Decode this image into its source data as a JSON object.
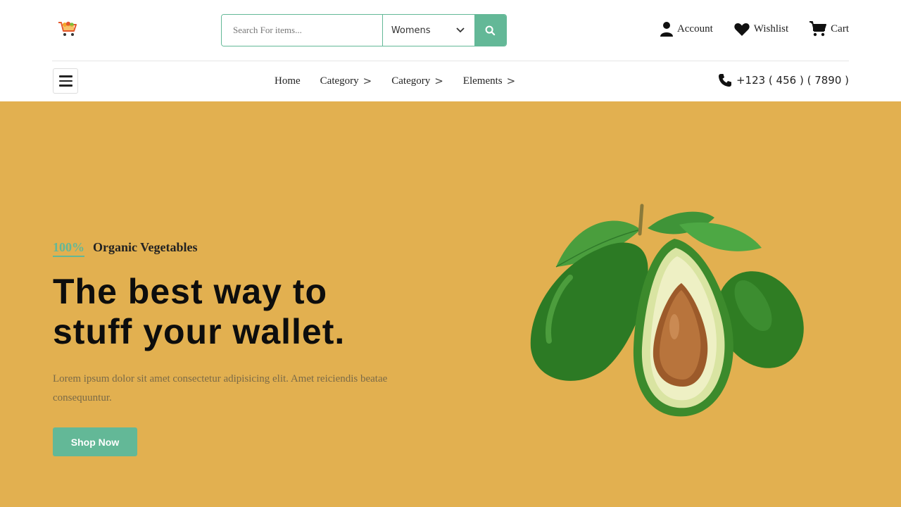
{
  "header": {
    "search": {
      "placeholder": "Search For items...",
      "category": "Womens"
    },
    "actions": {
      "account": "Account",
      "wishlist": "Wishlist",
      "cart": "Cart"
    }
  },
  "nav": {
    "links": [
      "Home",
      "Category",
      "Category",
      "Elements"
    ],
    "phone": "+123 ( 456 ) ( 7890 )"
  },
  "hero": {
    "tag_percent": "100%",
    "tag_text": "Organic Vegetables",
    "headline_line1": "The best way to",
    "headline_line2": "stuff your wallet.",
    "description": "Lorem ipsum dolor sit amet consectetur adipisicing elit. Amet reiciendis beatae consequuntur.",
    "cta": "Shop Now"
  },
  "colors": {
    "accent": "#63b897",
    "hero_background": "#e2b050",
    "text_dark": "#222222"
  },
  "icons": [
    "cart-logo-icon",
    "search-icon",
    "chevron-down-icon",
    "user-icon",
    "heart-icon",
    "cart-icon",
    "hamburger-icon",
    "phone-icon",
    "avocado-image"
  ]
}
